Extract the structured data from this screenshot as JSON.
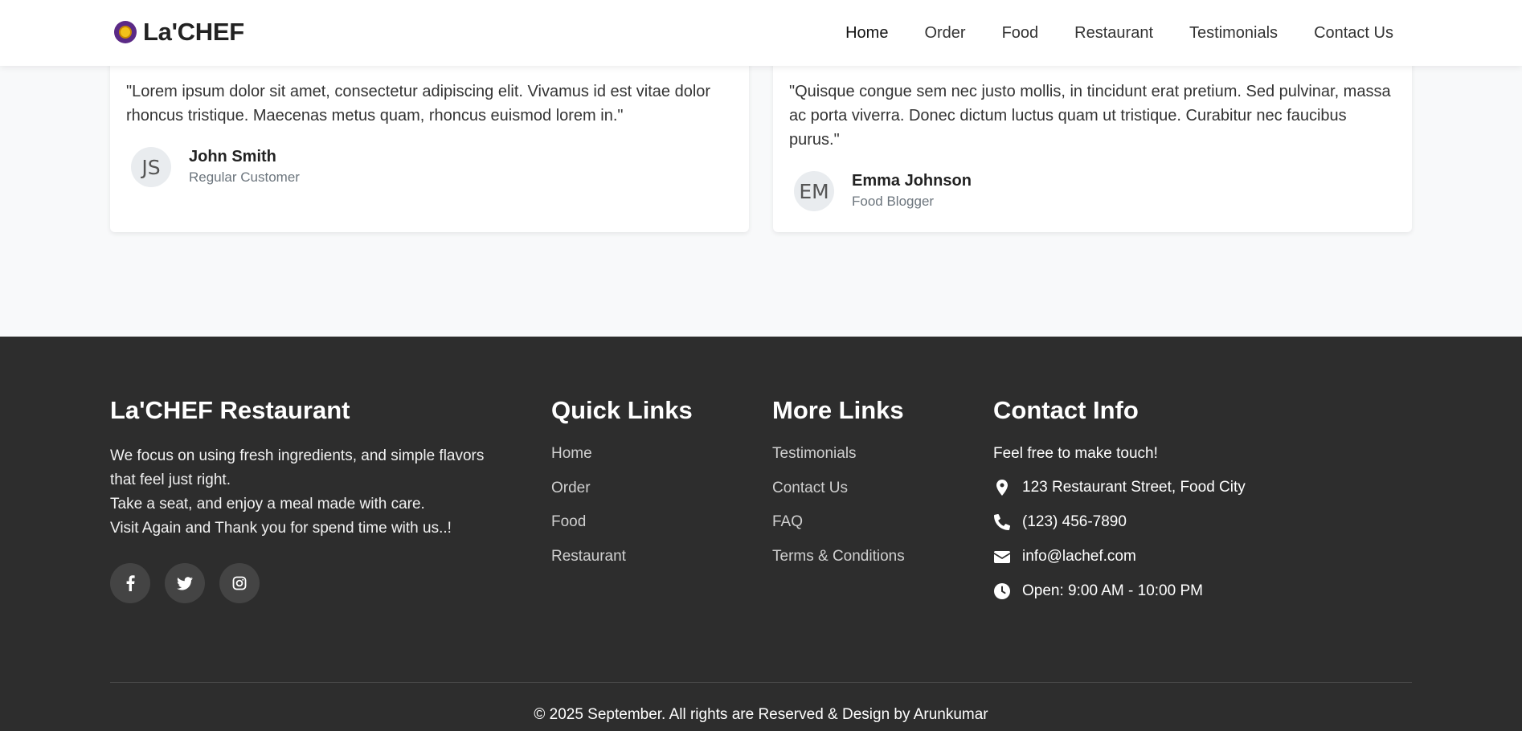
{
  "header": {
    "brand": "La'CHEF",
    "nav": [
      {
        "label": "Home",
        "active": true
      },
      {
        "label": "Order"
      },
      {
        "label": "Food"
      },
      {
        "label": "Restaurant"
      },
      {
        "label": "Testimonials"
      },
      {
        "label": "Contact Us"
      }
    ]
  },
  "testimonials": [
    {
      "quote": "\"Lorem ipsum dolor sit amet, consectetur adipiscing elit. Vivamus id est vitae dolor rhoncus tristique. Maecenas metus quam, rhoncus euismod lorem in.\"",
      "initials": "JS",
      "name": "John Smith",
      "role": "Regular Customer"
    },
    {
      "quote": "\"Quisque congue sem nec justo mollis, in tincidunt erat pretium. Sed pulvinar, massa ac porta viverra. Donec dictum luctus quam ut tristique. Curabitur nec faucibus purus.\"",
      "initials": "EM",
      "name": "Emma Johnson",
      "role": "Food Blogger"
    }
  ],
  "footer": {
    "about": {
      "title": "La'CHEF Restaurant",
      "lines": [
        "We focus on using fresh ingredients, and simple flavors that feel just right.",
        "Take a seat, and enjoy a meal made with care.",
        "Visit Again and Thank you for spend time with us..!"
      ],
      "socials": [
        "facebook-icon",
        "twitter-icon",
        "instagram-icon"
      ]
    },
    "quick_links": {
      "title": "Quick Links",
      "items": [
        "Home",
        "Order",
        "Food",
        "Restaurant"
      ]
    },
    "more_links": {
      "title": "More Links",
      "items": [
        "Testimonials",
        "Contact Us",
        "FAQ",
        "Terms & Conditions"
      ]
    },
    "contact": {
      "title": "Contact Info",
      "tagline": "Feel free to make touch!",
      "items": [
        {
          "icon": "location-pin-icon",
          "text": "123 Restaurant Street, Food City"
        },
        {
          "icon": "phone-icon",
          "text": "(123) 456-7890"
        },
        {
          "icon": "envelope-icon",
          "text": "info@lachef.com"
        },
        {
          "icon": "clock-icon",
          "text": "Open: 9:00 AM - 10:00 PM"
        }
      ]
    },
    "copyright": "© 2025 September. All rights are Reserved & Design by Arunkumar"
  },
  "colors": {
    "footer_bg": "#2d2d2d",
    "page_bg": "#f8f9fa",
    "brand_purple": "#5b2a86",
    "brand_gold": "#f2c21b"
  }
}
